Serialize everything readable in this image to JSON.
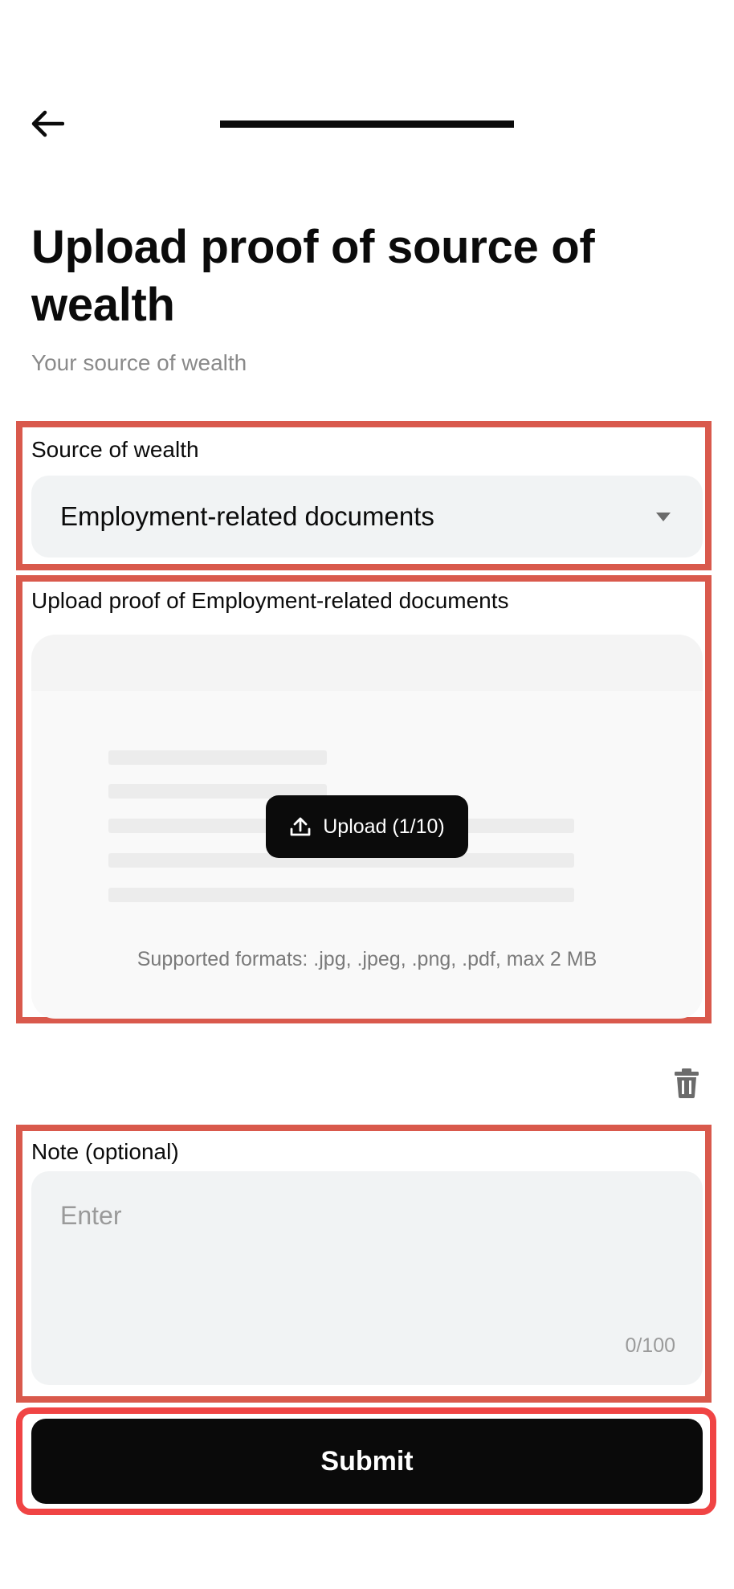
{
  "header": {
    "back_icon": "arrow-left-icon",
    "progress": 1.0
  },
  "page": {
    "title": "Upload proof of source of wealth",
    "subtitle": "Your source of wealth"
  },
  "source_field": {
    "label": "Source of wealth",
    "value": "Employment-related documents",
    "icon": "caret-down-icon"
  },
  "upload_field": {
    "label": "Upload proof of Employment-related documents",
    "button_label": "Upload (1/10)",
    "button_icon": "upload-icon",
    "formats_text": "Supported formats: .jpg, .jpeg, .png, .pdf, max 2 MB",
    "delete_icon": "trash-icon"
  },
  "note_field": {
    "label": "Note (optional)",
    "placeholder": "Enter",
    "value": "",
    "counter": "0/100"
  },
  "submit": {
    "label": "Submit"
  },
  "colors": {
    "annotation": "#d9594c",
    "annotation_submit": "#f04444",
    "field_bg": "#f1f3f4",
    "primary": "#0b0b0b"
  }
}
